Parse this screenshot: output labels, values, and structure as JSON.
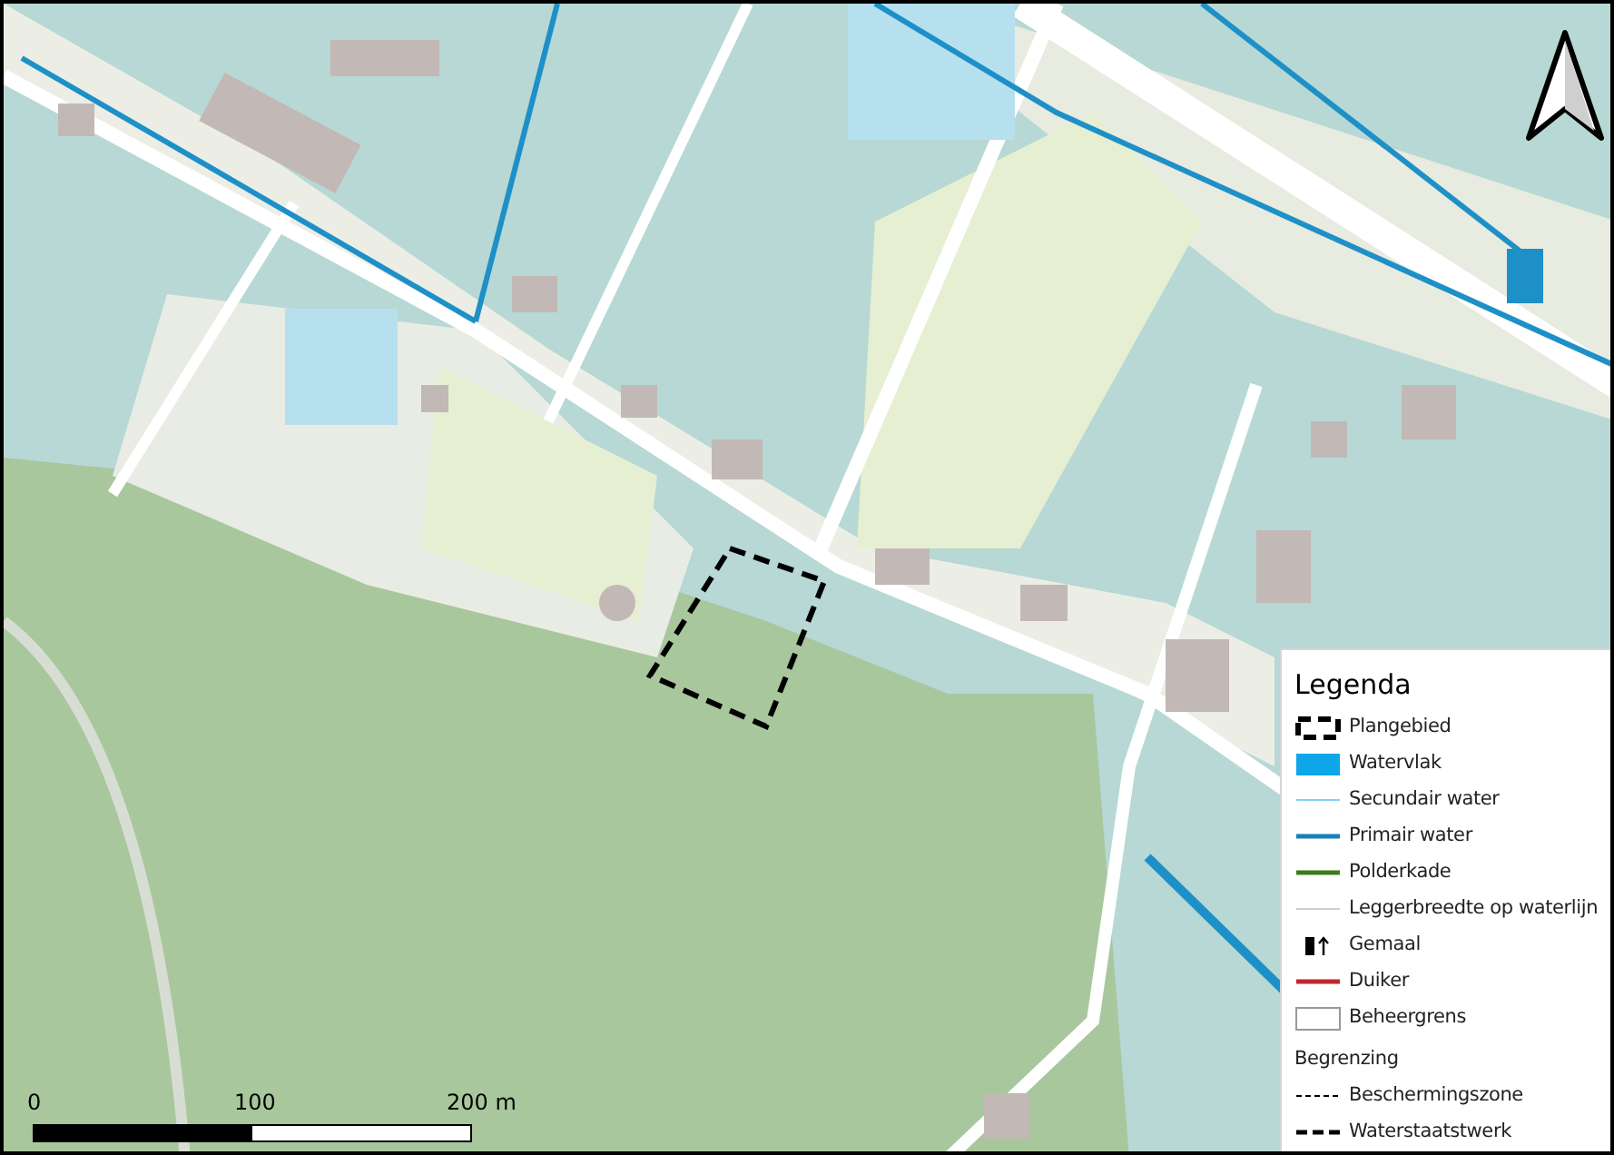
{
  "legend": {
    "title": "Legenda",
    "items": [
      {
        "kind": "dashed-box",
        "label": "Plangebied"
      },
      {
        "kind": "fill",
        "color": "#0ea5e9",
        "label": "Watervlak"
      },
      {
        "kind": "thin-line",
        "color": "#7dd3fc",
        "label": "Secundair water"
      },
      {
        "kind": "line",
        "color": "#1581b8",
        "label": "Primair water"
      },
      {
        "kind": "line",
        "color": "#3f7a1c",
        "label": "Polderkade"
      },
      {
        "kind": "thin-line",
        "color": "#c8d0d4",
        "label": "Leggerbreedte op waterlijn"
      },
      {
        "kind": "pump",
        "label": "Gemaal"
      },
      {
        "kind": "line",
        "color": "#c0262d",
        "label": "Duiker"
      },
      {
        "kind": "outline",
        "label": "Beheergrens"
      },
      {
        "kind": "heading",
        "label": "Begrenzing"
      },
      {
        "kind": "dashed-line",
        "label": "Beschermingszone"
      },
      {
        "kind": "thick-dashed-line",
        "label": "Waterstaatstwerk"
      }
    ]
  },
  "scale_bar": {
    "labels": [
      "0",
      "100",
      "200 m"
    ]
  }
}
